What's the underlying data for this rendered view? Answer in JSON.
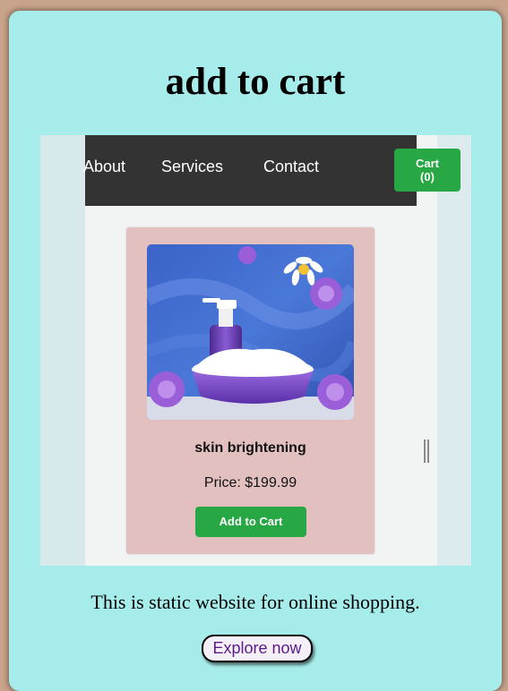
{
  "page": {
    "title": "add to cart",
    "description": "This is static website for online shopping.",
    "explore_label": "Explore now"
  },
  "screenshot": {
    "nav": {
      "links": [
        "About",
        "Services",
        "Contact"
      ],
      "cart_line1": "Cart",
      "cart_line2": "(0)"
    },
    "product": {
      "name": "skin brightening",
      "price": "Price: $199.99",
      "add_label": "Add to Cart",
      "image_icon": "cream-jar-image"
    }
  },
  "colors": {
    "background": "#a6eceb",
    "navbar": "#333333",
    "accent_green": "#27a844",
    "product_card": "#e3c0c0",
    "link_purple": "#5b1a8b"
  }
}
